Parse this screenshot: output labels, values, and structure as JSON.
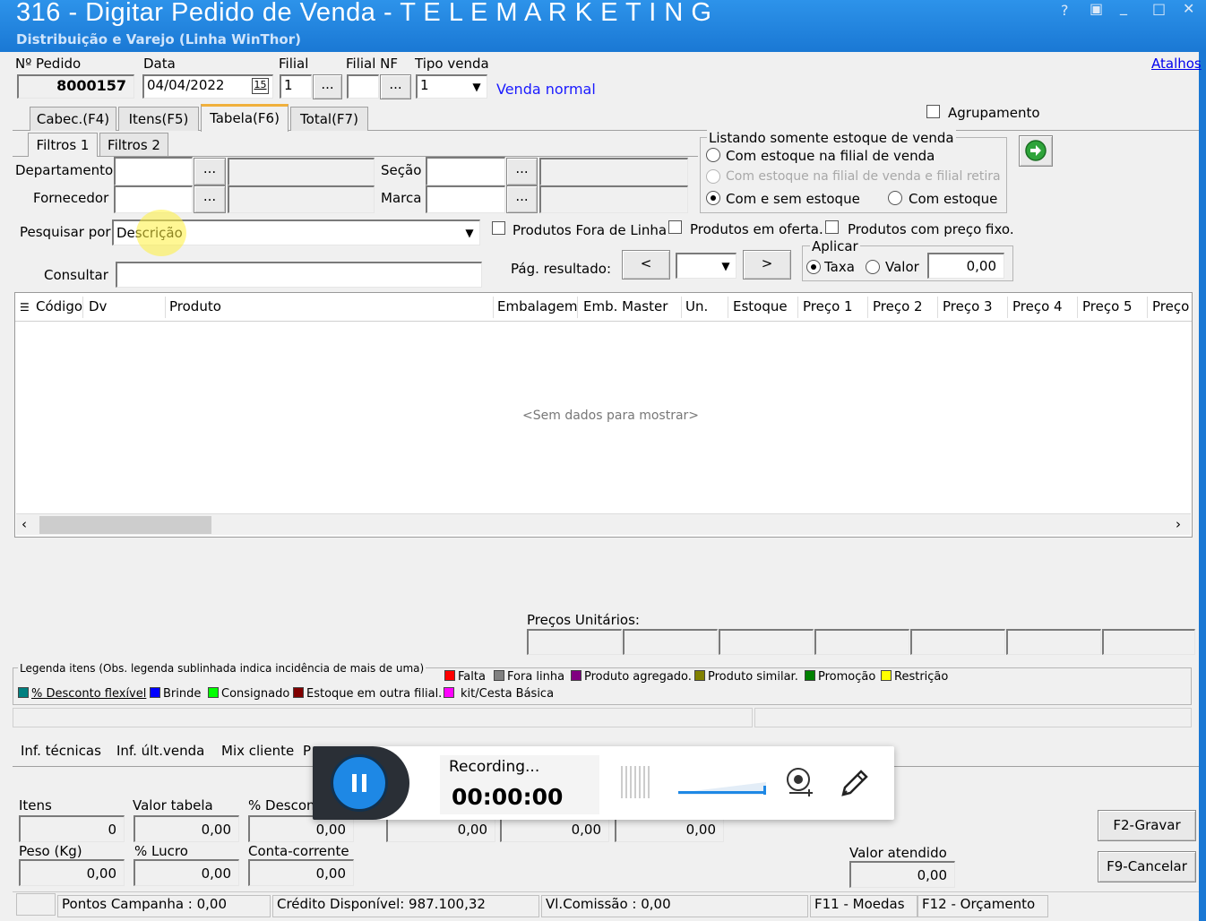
{
  "window": {
    "title": "316 - Digitar Pedido de Venda - T E L E M A R K E T I N G",
    "subtitle": "Distribuição e Varejo (Linha WinThor)",
    "controls": [
      "?",
      "▣",
      "_",
      "□",
      "✕"
    ]
  },
  "header": {
    "pedido_label": "Nº Pedido",
    "pedido_value": "8000157",
    "data_label": "Data",
    "data_value": "04/04/2022",
    "calendar_text": "15",
    "filial_label": "Filial",
    "filial_value": "1",
    "filialnf_label": "Filial NF",
    "filialnf_value": "",
    "tipo_label": "Tipo venda",
    "tipo_value": "1",
    "tipo_desc": "Venda normal",
    "lookup_text": "...",
    "atalhos": "Atalhos"
  },
  "main_tabs": [
    "Cabec.(F4)",
    "Itens(F5)",
    "Tabela(F6)",
    "Total(F7)"
  ],
  "agrupamento": "Agrupamento",
  "filter_tabs": [
    "Filtros 1",
    "Filtros 2"
  ],
  "filters": {
    "departamento": "Departamento",
    "fornecedor": "Fornecedor",
    "secao": "Seção",
    "marca": "Marca",
    "pesquisar_por": "Pesquisar por",
    "pesquisar_value": "Descrição",
    "consultar": "Consultar",
    "fora_linha": "Produtos Fora de Linha",
    "em_oferta": "Produtos em oferta.",
    "preco_fixo": "Produtos com preço fixo."
  },
  "stock": {
    "title": "Listando somente estoque de venda",
    "opt1": "Com estoque na filial de venda",
    "opt2": "Com estoque na filial de venda e filial retira",
    "opt3": "Com e sem estoque",
    "opt4": "Com estoque"
  },
  "pagination": {
    "label": "Pág. resultado:",
    "prev": "<",
    "next": ">"
  },
  "aplicar": {
    "title": "Aplicar",
    "taxa": "Taxa",
    "valor": "Valor",
    "value": "0,00"
  },
  "grid": {
    "columns": [
      "Código",
      "Dv",
      "Produto",
      "Embalagem",
      "Emb. Master",
      "Un.",
      "Estoque",
      "Preço 1",
      "Preço 2",
      "Preço 3",
      "Preço 4",
      "Preço 5",
      "Preço"
    ],
    "empty": "<Sem dados para mostrar>"
  },
  "precos_unitarios": "Preços Unitários:",
  "legend": {
    "title": "Legenda itens (Obs. legenda sublinhada indica incidência de mais de uma)",
    "items": [
      {
        "label": "Falta",
        "color": "#ff0000"
      },
      {
        "label": "Fora linha",
        "color": "#808080"
      },
      {
        "label": "Produto agregado.",
        "color": "#800080"
      },
      {
        "label": "Produto similar.",
        "color": "#808000"
      },
      {
        "label": "Promoção",
        "color": "#008000"
      },
      {
        "label": "Restrição",
        "color": "#ffff00"
      },
      {
        "label": "% Desconto flexível",
        "color": "#008080"
      },
      {
        "label": "Brinde",
        "color": "#0000ff"
      },
      {
        "label": "Consignado",
        "color": "#00ff00"
      },
      {
        "label": "Estoque em outra filial.",
        "color": "#800000"
      },
      {
        "label": "kit/Cesta Básica",
        "color": "#ff00ff"
      }
    ]
  },
  "info_tabs": [
    "Inf. técnicas",
    "Inf. últ.venda",
    "Mix cliente",
    "P"
  ],
  "totals": {
    "itens_label": "Itens",
    "itens_value": "0",
    "valor_tabela_label": "Valor tabela",
    "valor_tabela_value": "0,00",
    "desconto_label": "% Descon",
    "desconto_value": "0,00",
    "v4": "0,00",
    "v5": "0,00",
    "v6": "0,00",
    "peso_label": "Peso (Kg)",
    "peso_value": "0,00",
    "lucro_label": "% Lucro",
    "lucro_value": "0,00",
    "cc_label": "Conta-corrente",
    "cc_value": "0,00",
    "valor_atendido_label": "Valor atendido",
    "valor_atendido_value": "0,00",
    "gravar": "F2-Gravar",
    "cancelar": "F9-Cancelar"
  },
  "status": {
    "pontos": "Pontos Campanha : 0,00",
    "credito": "Crédito Disponível: 987.100,32",
    "comissao": "Vl.Comissão : 0,00",
    "moedas": "F11 - Moedas",
    "orcamento": "F12 - Orçamento"
  },
  "recorder": {
    "status": "Recording...",
    "time": "00:00:00"
  },
  "colors": {
    "title_bar": "#1c7fd9",
    "link": "#0000ee",
    "accent_pause": "#1e88e5"
  }
}
